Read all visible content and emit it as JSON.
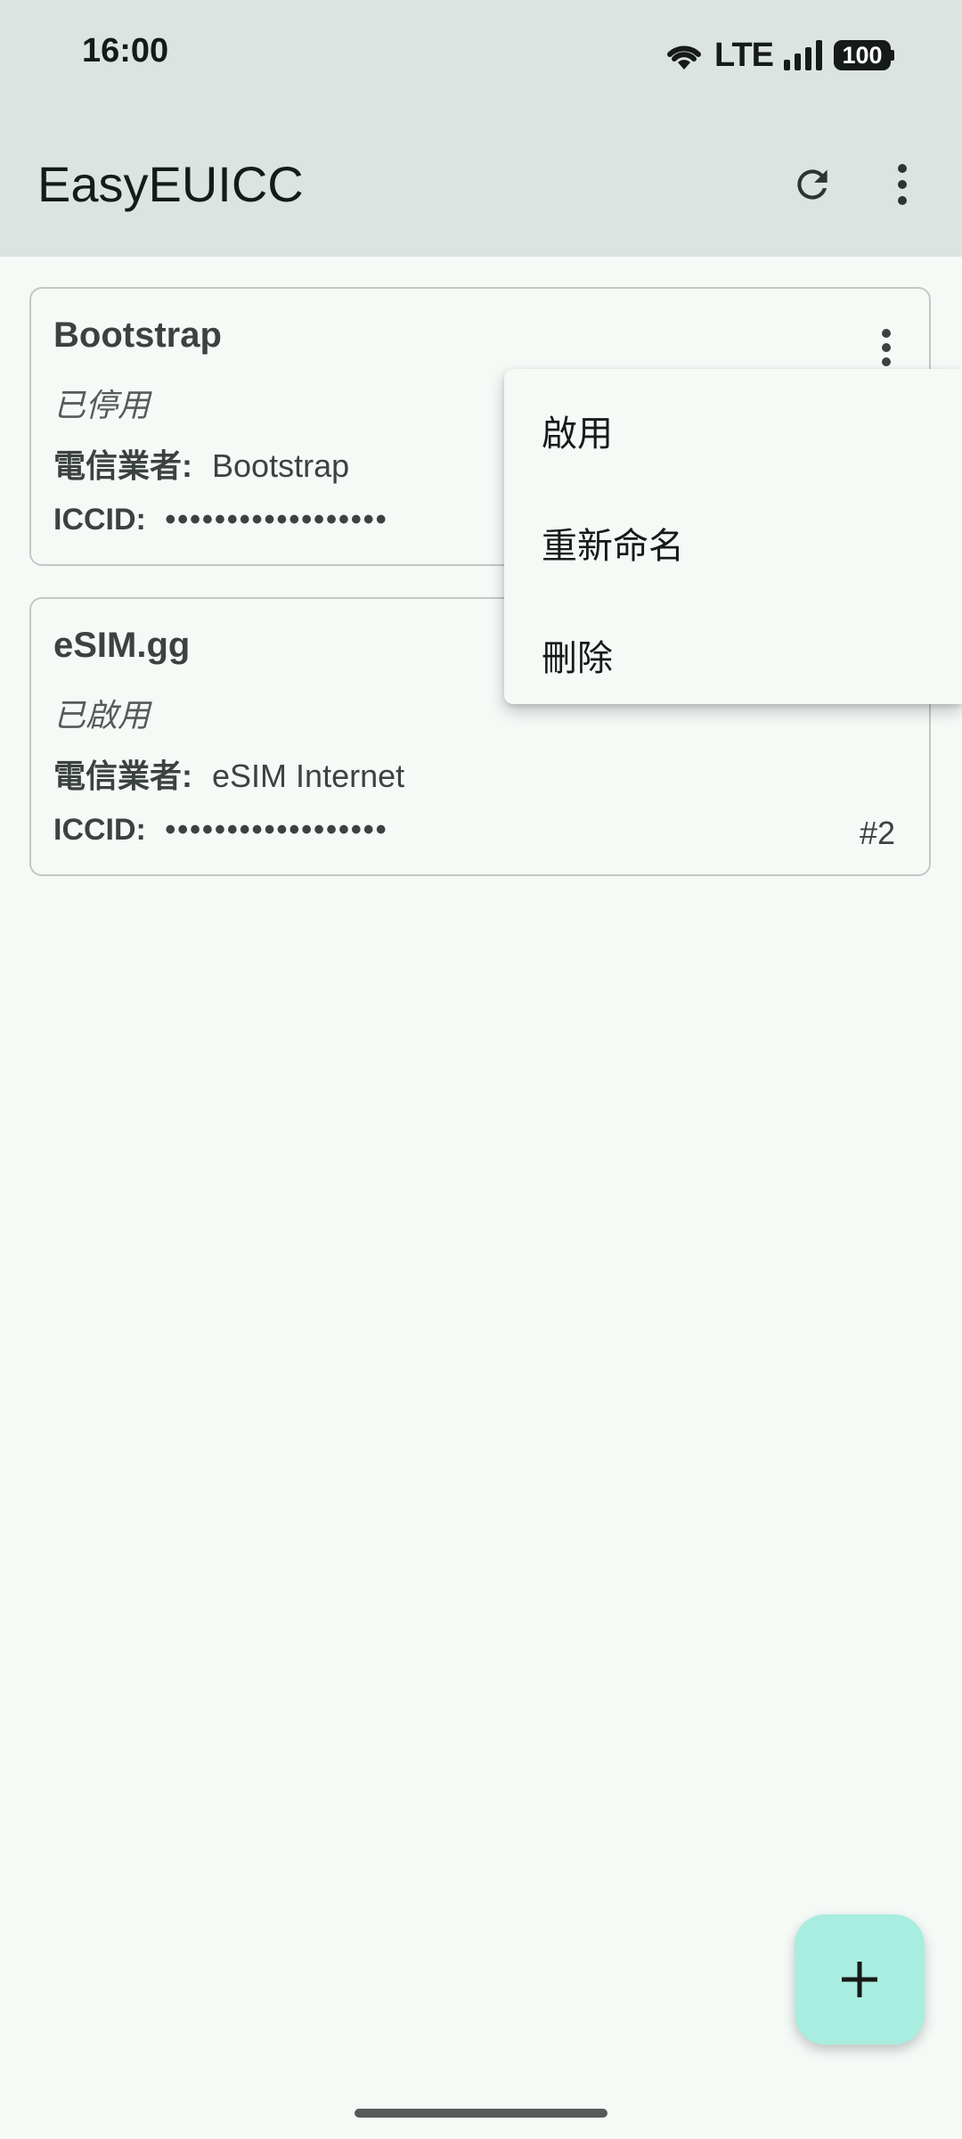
{
  "status_bar": {
    "time": "16:00",
    "network": "LTE",
    "battery": "100"
  },
  "app_bar": {
    "title": "EasyEUICC"
  },
  "profiles": [
    {
      "name": "Bootstrap",
      "state": "已停用",
      "carrier_label": "電信業者:",
      "carrier": "Bootstrap",
      "iccid_label": "ICCID:",
      "iccid": "••••••••••••••••••",
      "index": ""
    },
    {
      "name": "eSIM.gg",
      "state": "已啟用",
      "carrier_label": "電信業者:",
      "carrier": "eSIM Internet",
      "iccid_label": "ICCID:",
      "iccid": "••••••••••••••••••",
      "index": "#2"
    }
  ],
  "profile_menu": {
    "enable": "啟用",
    "rename": "重新命名",
    "delete": "刪除"
  },
  "colors": {
    "app_bar": "#dce4e1",
    "background": "#f5faf7",
    "fab": "#a9ede0"
  },
  "icons": {
    "refresh": "refresh-icon",
    "overflow": "more-vert-icon",
    "add": "add-icon"
  }
}
